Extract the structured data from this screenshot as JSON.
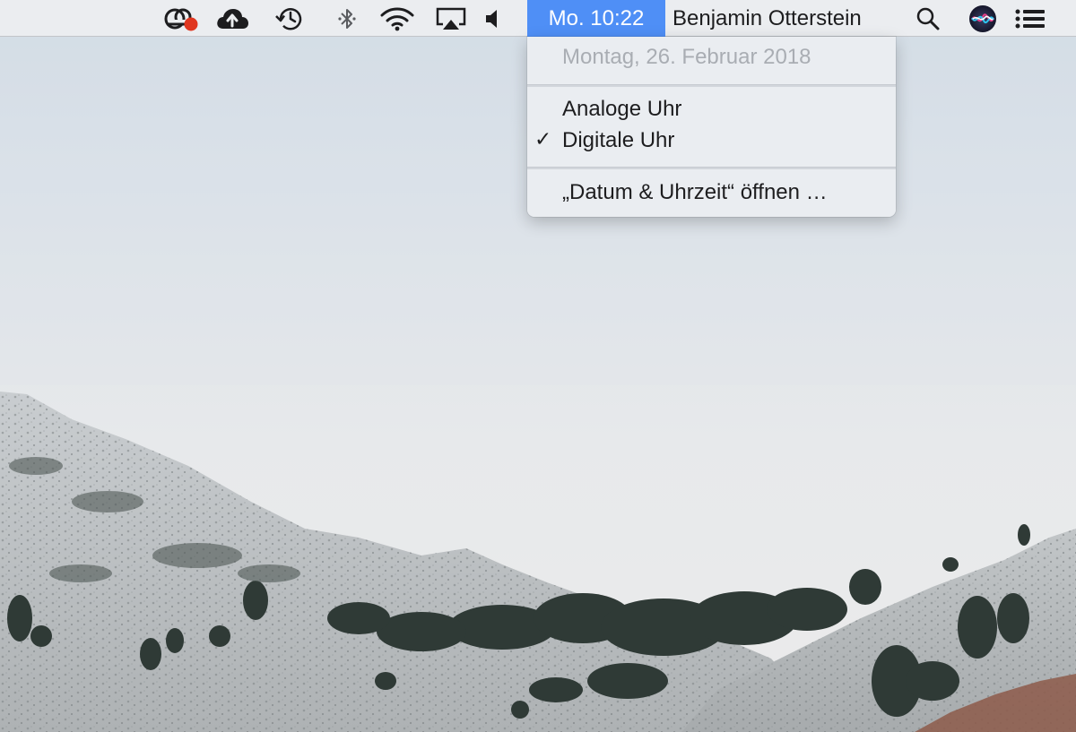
{
  "menubar": {
    "status_icons": [
      {
        "name": "creative-cloud-sync-icon",
        "badge_color": "#e0361f"
      },
      {
        "name": "icloud-upload-icon"
      },
      {
        "name": "time-machine-icon"
      },
      {
        "name": "bluetooth-icon"
      },
      {
        "name": "wifi-icon"
      },
      {
        "name": "airplay-icon"
      },
      {
        "name": "volume-icon"
      }
    ],
    "clock": "Mo. 10:22",
    "user": "Benjamin Otterstein",
    "right_icons": [
      {
        "name": "spotlight-search-icon"
      },
      {
        "name": "siri-icon"
      },
      {
        "name": "notification-center-icon"
      }
    ],
    "highlight_color": "#4f8ff6"
  },
  "clock_menu": {
    "date": "Montag, 26. Februar 2018",
    "items": [
      {
        "label": "Analoge Uhr",
        "checked": false
      },
      {
        "label": "Digitale Uhr",
        "checked": true
      }
    ],
    "check_mark": "✓",
    "open_prefs": "„Datum & Uhrzeit“ öffnen …"
  }
}
